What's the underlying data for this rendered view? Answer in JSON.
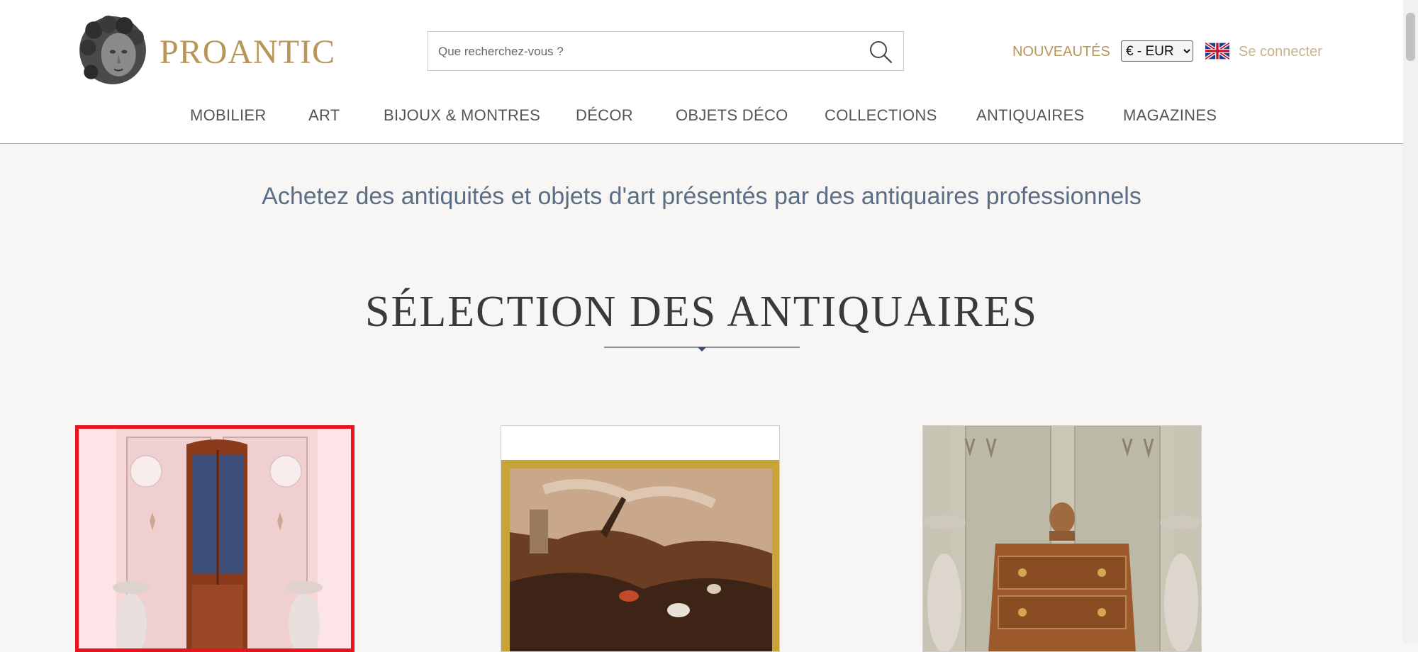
{
  "brand": {
    "name": "PROANTIC",
    "color": "#b8965a"
  },
  "search": {
    "placeholder": "Que recherchez-vous ?"
  },
  "header_links": {
    "nouveautes": "NOUVEAUTÉS",
    "currency": "€ - EUR",
    "language_flag": "uk-flag-icon",
    "login": "Se connecter"
  },
  "nav": {
    "items": [
      "MOBILIER",
      "ART",
      "BIJOUX & MONTRES",
      "DÉCOR",
      "OBJETS DÉCO",
      "COLLECTIONS",
      "ANTIQUAIRES",
      "MAGAZINES"
    ]
  },
  "tagline": "Achetez des antiquités et objets d'art présentés par des antiquaires professionnels",
  "section": {
    "title": "SÉLECTION DES ANTIQUAIRES"
  },
  "products": [
    {
      "image": "antique-bookcase-image",
      "selected": true
    },
    {
      "image": "battle-painting-image",
      "selected": false
    },
    {
      "image": "antique-commode-image",
      "selected": false
    }
  ],
  "colors": {
    "accent": "#b8965a",
    "tagline": "#5b6e86",
    "selection_border": "#e8141b",
    "background": "#f7f6f5"
  }
}
